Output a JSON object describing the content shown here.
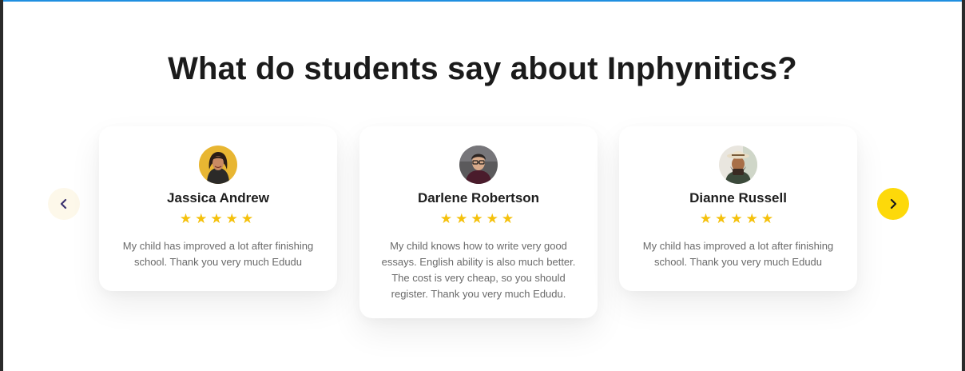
{
  "heading": "What do students say about Inphynitics?",
  "colors": {
    "accent": "#fdd90a",
    "star": "#f5c10c",
    "prev_bg": "#fdf8ea"
  },
  "carousel": {
    "prev_icon": "chevron-left-icon",
    "next_icon": "chevron-right-icon"
  },
  "testimonials": [
    {
      "name": "Jassica Andrew",
      "rating": 5,
      "review": "My child has improved a lot after finishing school. Thank you very much Edudu",
      "avatar": "woman-avatar"
    },
    {
      "name": "Darlene Robertson",
      "rating": 5,
      "review": "My child knows how to write very good essays. English ability is also much better. The cost is very cheap, so you should register. Thank you very much Edudu.",
      "avatar": "man-glasses-avatar"
    },
    {
      "name": "Dianne Russell",
      "rating": 5,
      "review": "My child has improved a lot after finishing school. Thank you very much Edudu",
      "avatar": "man-hat-avatar"
    }
  ]
}
